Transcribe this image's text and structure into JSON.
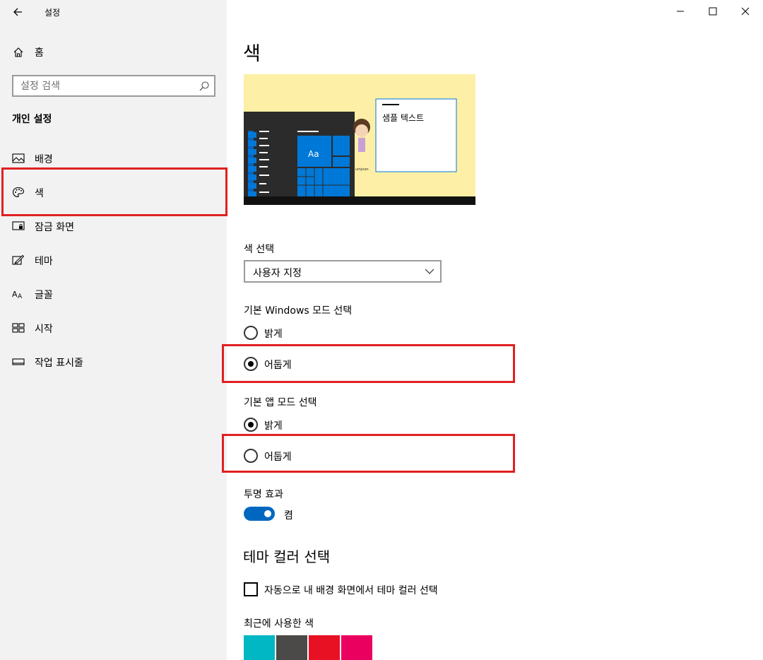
{
  "app": {
    "title": "설정"
  },
  "sidebar": {
    "home_label": "홈",
    "search_placeholder": "설정 검색",
    "section_heading": "개인 설정",
    "items": [
      {
        "label": "배경",
        "icon": "picture-icon"
      },
      {
        "label": "색",
        "icon": "palette-icon"
      },
      {
        "label": "잠금 화면",
        "icon": "lock-screen-icon"
      },
      {
        "label": "테마",
        "icon": "theme-brush-icon"
      },
      {
        "label": "글꼴",
        "icon": "font-icon"
      },
      {
        "label": "시작",
        "icon": "start-grid-icon"
      },
      {
        "label": "작업 표시줄",
        "icon": "taskbar-icon"
      }
    ],
    "selected_item": "색"
  },
  "main": {
    "title": "색",
    "preview": {
      "tile_label": "Aa",
      "sample_text": "샘플 텍스트"
    },
    "color_choice": {
      "label": "색 선택",
      "value": "사용자 지정"
    },
    "windows_mode": {
      "label": "기본 Windows 모드 선택",
      "options": [
        "밝게",
        "어둡게"
      ],
      "selected": "어둡게"
    },
    "app_mode": {
      "label": "기본 앱 모드 선택",
      "options": [
        "밝게",
        "어둡게"
      ],
      "selected": "밝게"
    },
    "transparency": {
      "label": "투명 효과",
      "state_label": "켬",
      "on": true
    },
    "theme_color": {
      "heading": "테마 컬러 선택",
      "auto_checkbox_label": "자동으로 내 배경 화면에서 테마 컬러 선택",
      "auto_checked": false,
      "recent_label": "최근에 사용한 색",
      "recent_colors": [
        "#00b7c3",
        "#4c4a48",
        "#e81123",
        "#ea005e"
      ]
    }
  },
  "colors": {
    "accent": "#0067c0",
    "highlight": "#e02020",
    "sidebar_bg": "#f2f2f2",
    "preview_bg": "#fdf0a6"
  }
}
